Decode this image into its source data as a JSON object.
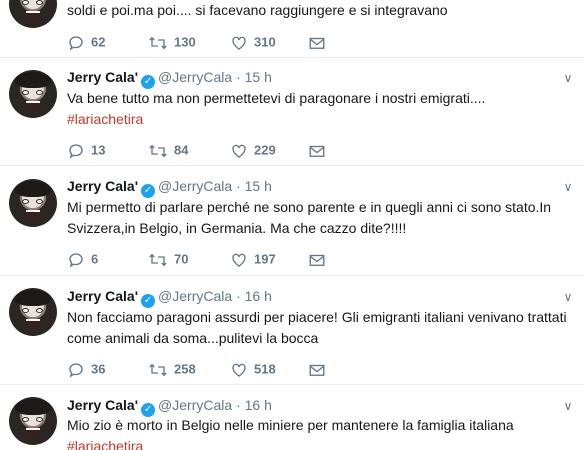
{
  "tweets": [
    {
      "partial": true,
      "text": "soldi e poi.ma poi.... si facevano raggiungere e si integravano",
      "replies": "62",
      "retweets": "130",
      "likes": "310"
    },
    {
      "name": "Jerry Cala'",
      "handle": "@JerryCala",
      "dot": "·",
      "time": "15 h",
      "text": "Va bene tutto ma non permettetevi di paragonare i nostri emigrati....",
      "hashtag": "#lariachetira",
      "replies": "13",
      "retweets": "84",
      "likes": "229"
    },
    {
      "name": "Jerry Cala'",
      "handle": "@JerryCala",
      "dot": "·",
      "time": "15 h",
      "text": "Mi permetto di parlare perché ne sono parente e in quegli anni ci sono stato.In Svizzera,in Belgio, in Germania. Ma che  cazzo dite?!!!!",
      "replies": "6",
      "retweets": "70",
      "likes": "197"
    },
    {
      "name": "Jerry Cala'",
      "handle": "@JerryCala",
      "dot": "·",
      "time": "16 h",
      "text": "Non facciamo paragoni assurdi per piacere! Gli emigranti italiani venivano trattati come animali da soma...pulitevi la bocca",
      "replies": "36",
      "retweets": "258",
      "likes": "518"
    },
    {
      "name": "Jerry Cala'",
      "handle": "@JerryCala",
      "dot": "·",
      "time": "16 h",
      "text": "Mio zio è morto in Belgio nelle miniere per mantenere la famiglia italiana",
      "hashtag": "#lariachetira"
    }
  ],
  "icons": {
    "verified": "✓",
    "chevron": "∨"
  },
  "colors": {
    "hashtag": "#c0392b",
    "verified": "#1da1f2",
    "muted": "#657786"
  }
}
